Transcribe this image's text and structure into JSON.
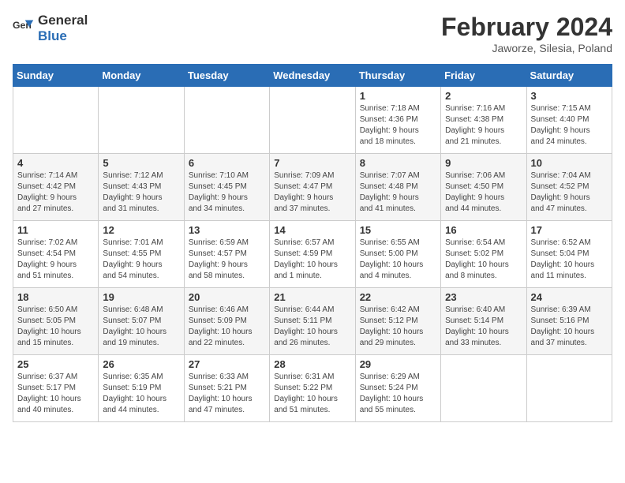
{
  "logo": {
    "line1": "General",
    "line2": "Blue"
  },
  "title": "February 2024",
  "subtitle": "Jaworze, Silesia, Poland",
  "headers": [
    "Sunday",
    "Monday",
    "Tuesday",
    "Wednesday",
    "Thursday",
    "Friday",
    "Saturday"
  ],
  "weeks": [
    [
      {
        "day": "",
        "info": ""
      },
      {
        "day": "",
        "info": ""
      },
      {
        "day": "",
        "info": ""
      },
      {
        "day": "",
        "info": ""
      },
      {
        "day": "1",
        "info": "Sunrise: 7:18 AM\nSunset: 4:36 PM\nDaylight: 9 hours\nand 18 minutes."
      },
      {
        "day": "2",
        "info": "Sunrise: 7:16 AM\nSunset: 4:38 PM\nDaylight: 9 hours\nand 21 minutes."
      },
      {
        "day": "3",
        "info": "Sunrise: 7:15 AM\nSunset: 4:40 PM\nDaylight: 9 hours\nand 24 minutes."
      }
    ],
    [
      {
        "day": "4",
        "info": "Sunrise: 7:14 AM\nSunset: 4:42 PM\nDaylight: 9 hours\nand 27 minutes."
      },
      {
        "day": "5",
        "info": "Sunrise: 7:12 AM\nSunset: 4:43 PM\nDaylight: 9 hours\nand 31 minutes."
      },
      {
        "day": "6",
        "info": "Sunrise: 7:10 AM\nSunset: 4:45 PM\nDaylight: 9 hours\nand 34 minutes."
      },
      {
        "day": "7",
        "info": "Sunrise: 7:09 AM\nSunset: 4:47 PM\nDaylight: 9 hours\nand 37 minutes."
      },
      {
        "day": "8",
        "info": "Sunrise: 7:07 AM\nSunset: 4:48 PM\nDaylight: 9 hours\nand 41 minutes."
      },
      {
        "day": "9",
        "info": "Sunrise: 7:06 AM\nSunset: 4:50 PM\nDaylight: 9 hours\nand 44 minutes."
      },
      {
        "day": "10",
        "info": "Sunrise: 7:04 AM\nSunset: 4:52 PM\nDaylight: 9 hours\nand 47 minutes."
      }
    ],
    [
      {
        "day": "11",
        "info": "Sunrise: 7:02 AM\nSunset: 4:54 PM\nDaylight: 9 hours\nand 51 minutes."
      },
      {
        "day": "12",
        "info": "Sunrise: 7:01 AM\nSunset: 4:55 PM\nDaylight: 9 hours\nand 54 minutes."
      },
      {
        "day": "13",
        "info": "Sunrise: 6:59 AM\nSunset: 4:57 PM\nDaylight: 9 hours\nand 58 minutes."
      },
      {
        "day": "14",
        "info": "Sunrise: 6:57 AM\nSunset: 4:59 PM\nDaylight: 10 hours\nand 1 minute."
      },
      {
        "day": "15",
        "info": "Sunrise: 6:55 AM\nSunset: 5:00 PM\nDaylight: 10 hours\nand 4 minutes."
      },
      {
        "day": "16",
        "info": "Sunrise: 6:54 AM\nSunset: 5:02 PM\nDaylight: 10 hours\nand 8 minutes."
      },
      {
        "day": "17",
        "info": "Sunrise: 6:52 AM\nSunset: 5:04 PM\nDaylight: 10 hours\nand 11 minutes."
      }
    ],
    [
      {
        "day": "18",
        "info": "Sunrise: 6:50 AM\nSunset: 5:05 PM\nDaylight: 10 hours\nand 15 minutes."
      },
      {
        "day": "19",
        "info": "Sunrise: 6:48 AM\nSunset: 5:07 PM\nDaylight: 10 hours\nand 19 minutes."
      },
      {
        "day": "20",
        "info": "Sunrise: 6:46 AM\nSunset: 5:09 PM\nDaylight: 10 hours\nand 22 minutes."
      },
      {
        "day": "21",
        "info": "Sunrise: 6:44 AM\nSunset: 5:11 PM\nDaylight: 10 hours\nand 26 minutes."
      },
      {
        "day": "22",
        "info": "Sunrise: 6:42 AM\nSunset: 5:12 PM\nDaylight: 10 hours\nand 29 minutes."
      },
      {
        "day": "23",
        "info": "Sunrise: 6:40 AM\nSunset: 5:14 PM\nDaylight: 10 hours\nand 33 minutes."
      },
      {
        "day": "24",
        "info": "Sunrise: 6:39 AM\nSunset: 5:16 PM\nDaylight: 10 hours\nand 37 minutes."
      }
    ],
    [
      {
        "day": "25",
        "info": "Sunrise: 6:37 AM\nSunset: 5:17 PM\nDaylight: 10 hours\nand 40 minutes."
      },
      {
        "day": "26",
        "info": "Sunrise: 6:35 AM\nSunset: 5:19 PM\nDaylight: 10 hours\nand 44 minutes."
      },
      {
        "day": "27",
        "info": "Sunrise: 6:33 AM\nSunset: 5:21 PM\nDaylight: 10 hours\nand 47 minutes."
      },
      {
        "day": "28",
        "info": "Sunrise: 6:31 AM\nSunset: 5:22 PM\nDaylight: 10 hours\nand 51 minutes."
      },
      {
        "day": "29",
        "info": "Sunrise: 6:29 AM\nSunset: 5:24 PM\nDaylight: 10 hours\nand 55 minutes."
      },
      {
        "day": "",
        "info": ""
      },
      {
        "day": "",
        "info": ""
      }
    ]
  ]
}
